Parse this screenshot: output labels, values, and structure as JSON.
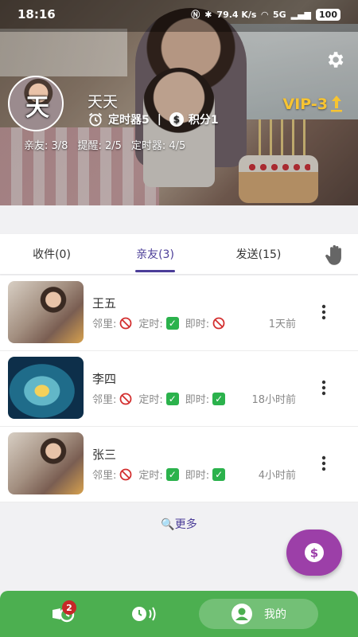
{
  "status_bar": {
    "time": "18:16",
    "net_speed": "79.4 K/s",
    "signal": "5G",
    "battery": "100"
  },
  "profile": {
    "avatar_char": "天",
    "username": "天天",
    "timer_label": "定时器5",
    "points_label": "积分1",
    "vip": "VIP-3",
    "limits": [
      "亲友: 3/8",
      "提醒: 2/5",
      "定时器: 4/5"
    ]
  },
  "tabs": [
    {
      "label": "收件(0)",
      "active": false
    },
    {
      "label": "亲友(3)",
      "active": true
    },
    {
      "label": "发送(15)",
      "active": false
    }
  ],
  "friends": [
    {
      "name": "王五",
      "neighbor_label": "邻里:",
      "neighbor": false,
      "scheduled_label": "定时:",
      "scheduled": true,
      "instant_label": "即时:",
      "instant": false,
      "time": "1天前",
      "thumb": "photo"
    },
    {
      "name": "李四",
      "neighbor_label": "邻里:",
      "neighbor": false,
      "scheduled_label": "定时:",
      "scheduled": true,
      "instant_label": "即时:",
      "instant": true,
      "time": "18小时前",
      "thumb": "wave"
    },
    {
      "name": "张三",
      "neighbor_label": "邻里:",
      "neighbor": false,
      "scheduled_label": "定时:",
      "scheduled": true,
      "instant_label": "即时:",
      "instant": true,
      "time": "4小时前",
      "thumb": "photo"
    }
  ],
  "more_link": "更多",
  "bottom_nav": {
    "badge_count": "2",
    "me_label": "我的"
  },
  "colors": {
    "accent": "#4b3d98",
    "nav": "#4caf50",
    "fab": "#9c3fa8",
    "vip": "#f7c431",
    "ok": "#2bb24c",
    "no": "#d32f2f"
  }
}
